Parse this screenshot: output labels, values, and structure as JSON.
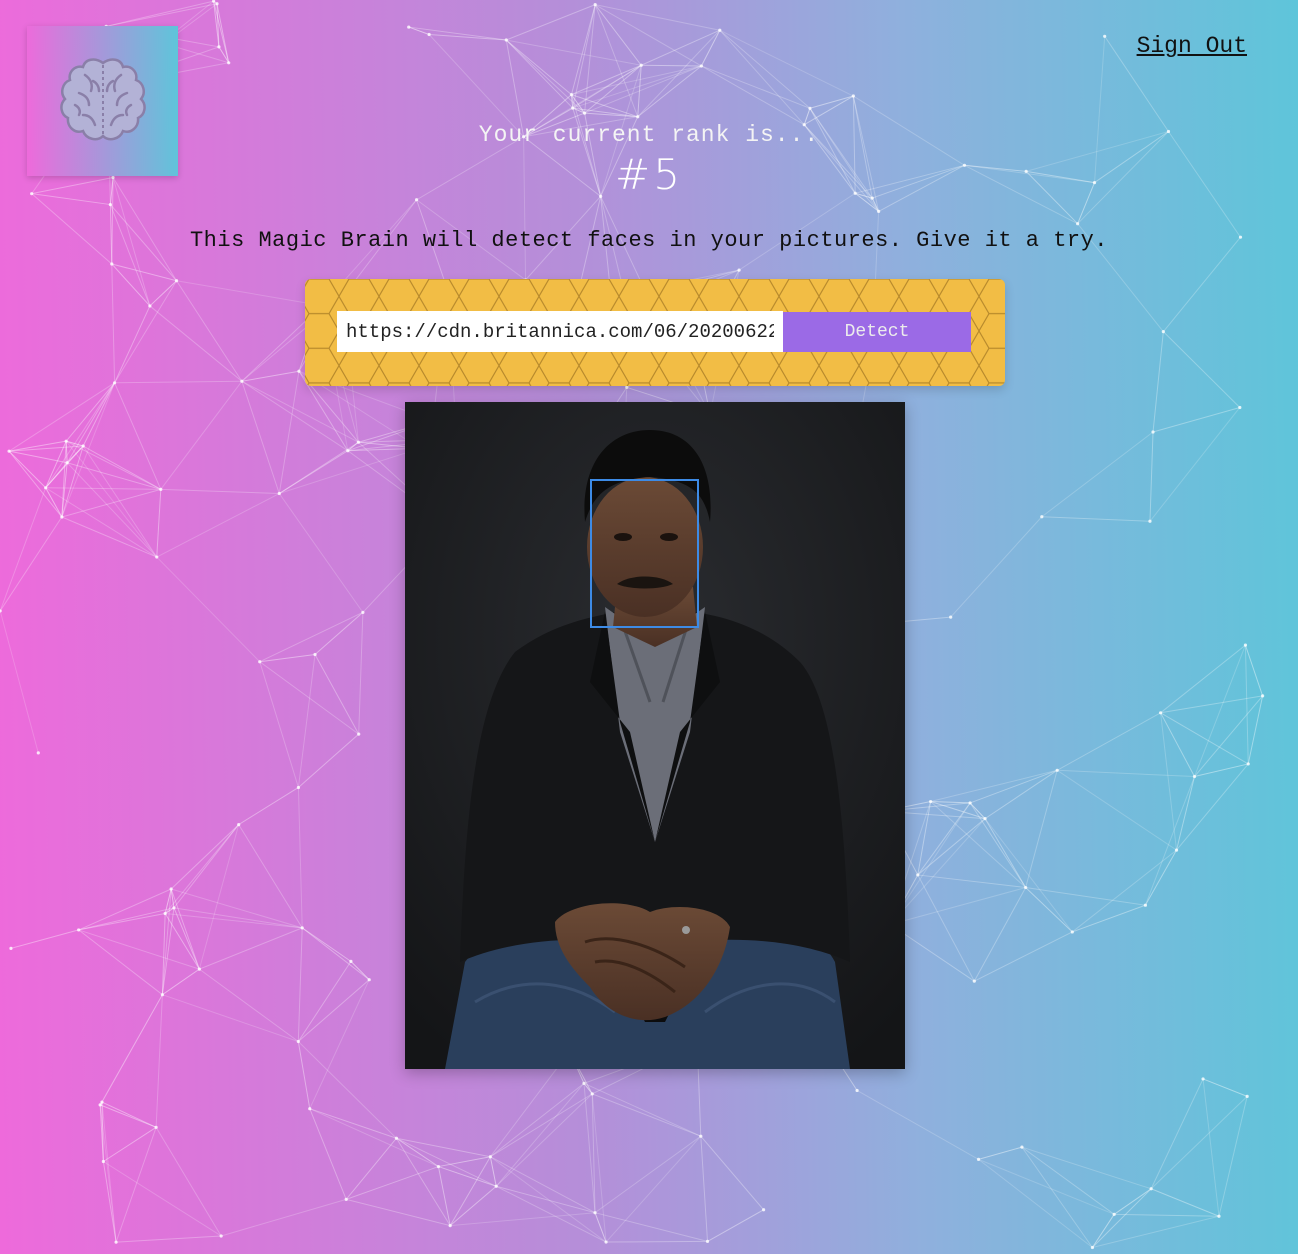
{
  "header": {
    "sign_out_label": "Sign Out"
  },
  "rank": {
    "intro": "Your current rank is...",
    "value": "#5"
  },
  "tagline": "This Magic Brain will detect faces in your pictures. Give it a try.",
  "form": {
    "url_value": "https://cdn.britannica.com/06/20200622",
    "detect_label": "Detect"
  },
  "icons": {
    "logo": "brain-icon"
  },
  "colors": {
    "gradient_left": "#ee6adb",
    "gradient_right": "#5ec5da",
    "panel": "#f2bd45",
    "detect_button": "#9b6ae6",
    "face_box": "#3d8be6"
  }
}
